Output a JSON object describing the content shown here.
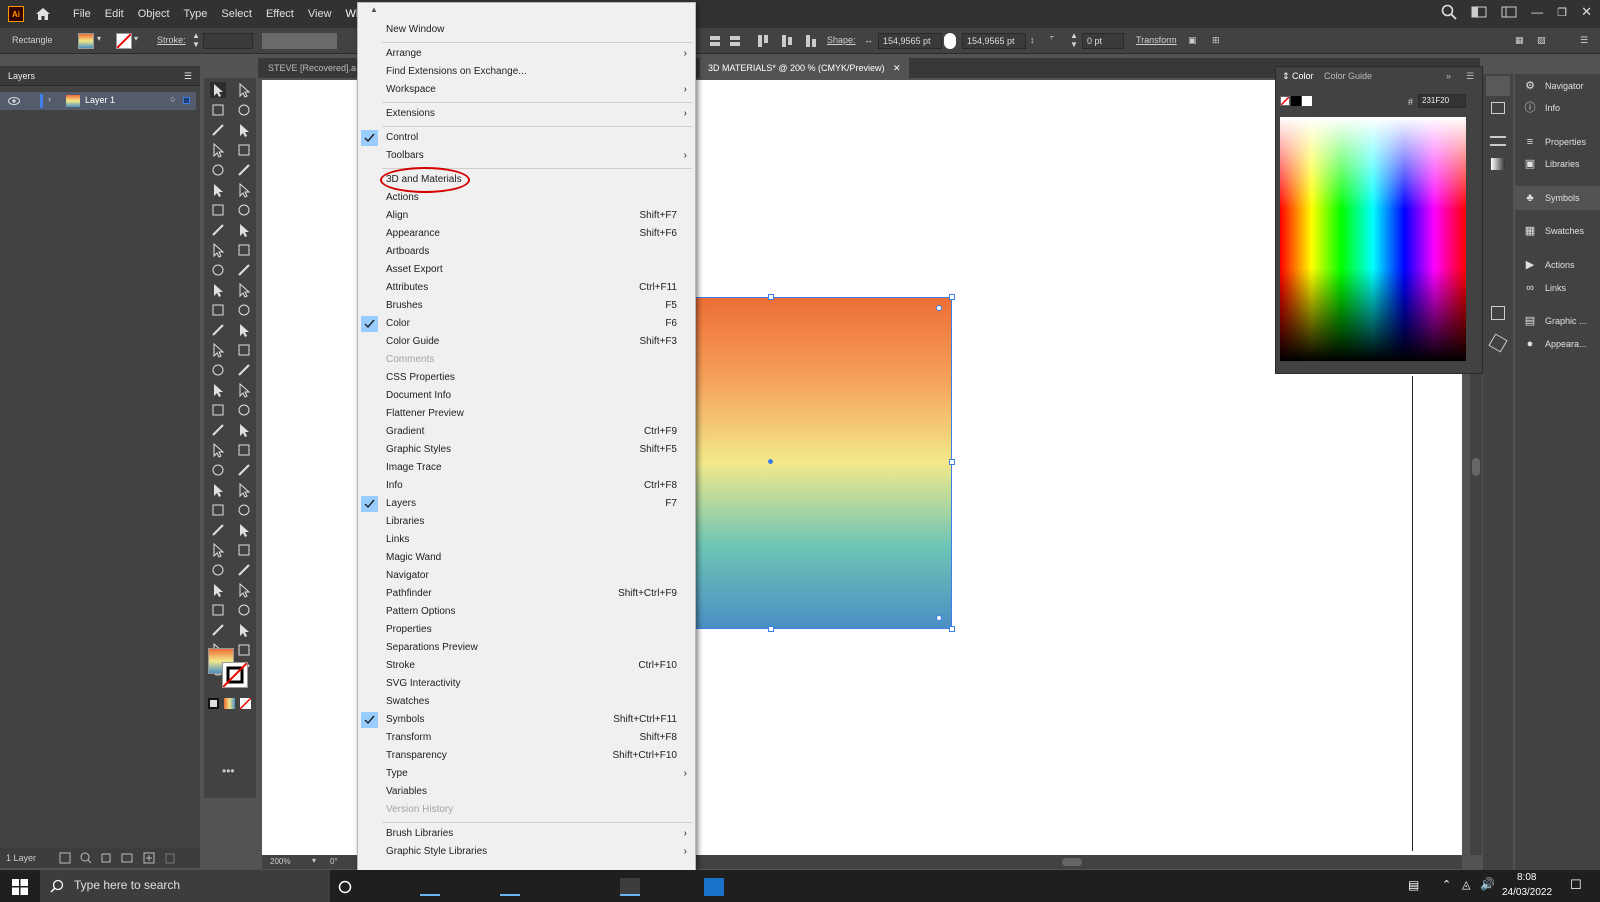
{
  "app": {
    "logo": "Ai"
  },
  "menubar": {
    "items": [
      "File",
      "Edit",
      "Object",
      "Type",
      "Select",
      "Effect",
      "View",
      "Window"
    ]
  },
  "controlbar": {
    "tool_name": "Rectangle",
    "stroke_label": "Stroke:",
    "shape_label": "Shape:",
    "width": "154,9565 pt",
    "height": "154,9565 pt",
    "corner": "0 pt",
    "transform_label": "Transform"
  },
  "layers_panel": {
    "title": "Layers",
    "layer_name": "Layer 1",
    "footer_count": "1 Layer"
  },
  "doc_tabs": [
    {
      "label": "STEVE [Recovered].a"
    },
    {
      "label": "3D MATERIALS* @ 200 % (CMYK/Preview)"
    }
  ],
  "statusbar": {
    "zoom": "200%",
    "angle": "0°"
  },
  "window_menu": {
    "items": [
      {
        "label": "New Window"
      },
      {
        "label": "Arrange",
        "submenu": true
      },
      {
        "label": "Find Extensions on Exchange..."
      },
      {
        "label": "Workspace",
        "submenu": true
      },
      {
        "label": "Extensions",
        "submenu": true
      },
      {
        "label": "Control",
        "checked": true
      },
      {
        "label": "Toolbars",
        "submenu": true
      },
      {
        "label": "3D and Materials",
        "highlighted": true
      },
      {
        "label": "Actions"
      },
      {
        "label": "Align",
        "shortcut": "Shift+F7"
      },
      {
        "label": "Appearance",
        "shortcut": "Shift+F6"
      },
      {
        "label": "Artboards"
      },
      {
        "label": "Asset Export"
      },
      {
        "label": "Attributes",
        "shortcut": "Ctrl+F11"
      },
      {
        "label": "Brushes",
        "shortcut": "F5"
      },
      {
        "label": "Color",
        "shortcut": "F6",
        "checked": true
      },
      {
        "label": "Color Guide",
        "shortcut": "Shift+F3"
      },
      {
        "label": "Comments",
        "disabled": true
      },
      {
        "label": "CSS Properties"
      },
      {
        "label": "Document Info"
      },
      {
        "label": "Flattener Preview"
      },
      {
        "label": "Gradient",
        "shortcut": "Ctrl+F9"
      },
      {
        "label": "Graphic Styles",
        "shortcut": "Shift+F5"
      },
      {
        "label": "Image Trace"
      },
      {
        "label": "Info",
        "shortcut": "Ctrl+F8"
      },
      {
        "label": "Layers",
        "shortcut": "F7",
        "checked": true
      },
      {
        "label": "Libraries"
      },
      {
        "label": "Links"
      },
      {
        "label": "Magic Wand"
      },
      {
        "label": "Navigator"
      },
      {
        "label": "Pathfinder",
        "shortcut": "Shift+Ctrl+F9"
      },
      {
        "label": "Pattern Options"
      },
      {
        "label": "Properties"
      },
      {
        "label": "Separations Preview"
      },
      {
        "label": "Stroke",
        "shortcut": "Ctrl+F10"
      },
      {
        "label": "SVG Interactivity"
      },
      {
        "label": "Swatches"
      },
      {
        "label": "Symbols",
        "shortcut": "Shift+Ctrl+F11",
        "checked": true
      },
      {
        "label": "Transform",
        "shortcut": "Shift+F8"
      },
      {
        "label": "Transparency",
        "shortcut": "Shift+Ctrl+F10"
      },
      {
        "label": "Type",
        "submenu": true
      },
      {
        "label": "Variables"
      },
      {
        "label": "Version History",
        "disabled": true
      },
      {
        "label": "Brush Libraries",
        "submenu": true
      },
      {
        "label": "Graphic Style Libraries",
        "submenu": true
      }
    ]
  },
  "color_panel": {
    "tabs": [
      "Color",
      "Color Guide"
    ],
    "hex_prefix": "#",
    "hex": "231F20"
  },
  "right_dock": {
    "items": [
      "Navigator",
      "Info",
      "Properties",
      "Libraries",
      "Symbols",
      "Swatches",
      "Actions",
      "Links",
      "Graphic ...",
      "Appeara..."
    ]
  },
  "taskbar": {
    "search_placeholder": "Type here to search",
    "time": "8:08",
    "date": "24/03/2022"
  },
  "colors": {
    "accent": "#3f7ee8",
    "check_bg": "#99ccff",
    "annotation": "#d40000"
  }
}
